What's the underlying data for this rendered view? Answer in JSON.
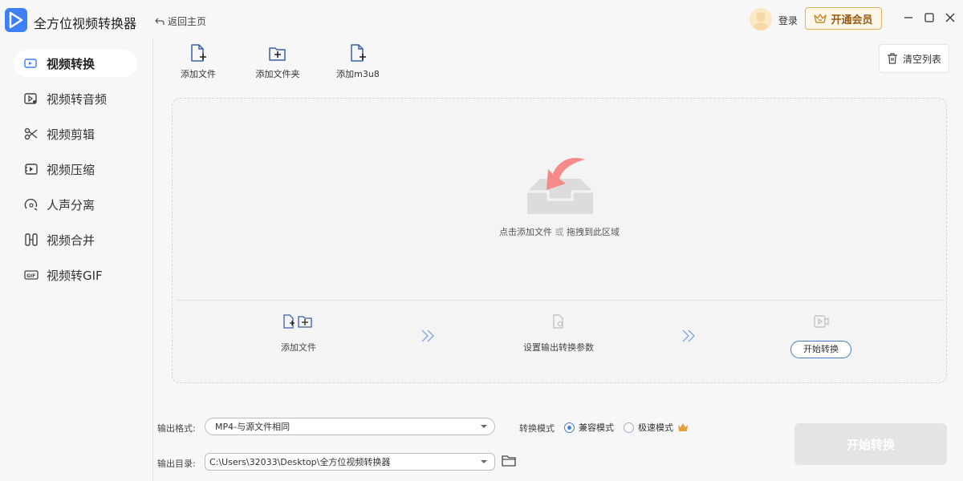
{
  "app": {
    "title": "全方位视频转换器",
    "back_label": "返回主页",
    "login_label": "登录",
    "vip_label": "开通会员",
    "accent_color": "#3d7ff5"
  },
  "sidebar": {
    "items": [
      {
        "label": "视频转换",
        "icon": "video-convert-icon",
        "active": true
      },
      {
        "label": "视频转音频",
        "icon": "video-to-audio-icon",
        "active": false
      },
      {
        "label": "视频剪辑",
        "icon": "scissors-icon",
        "active": false
      },
      {
        "label": "视频压缩",
        "icon": "compress-icon",
        "active": false
      },
      {
        "label": "人声分离",
        "icon": "voice-separation-icon",
        "active": false
      },
      {
        "label": "视频合并",
        "icon": "merge-icon",
        "active": false
      },
      {
        "label": "视频转GIF",
        "icon": "gif-icon",
        "active": false
      }
    ]
  },
  "toolbar": {
    "add_file_label": "添加文件",
    "add_folder_label": "添加文件夹",
    "add_m3u8_label": "添加m3u8",
    "clear_list_label": "清空列表"
  },
  "dropzone": {
    "hint_main": "点击添加文件",
    "hint_or": "或",
    "hint_drag": "拖拽到此区域"
  },
  "steps": {
    "step1_label": "添加文件",
    "step2_label": "设置输出转换参数",
    "step3_label": "开始转换"
  },
  "bottom": {
    "format_label": "输出格式:",
    "format_value": "MP4-与源文件相同",
    "mode_label": "转换模式",
    "mode_options": [
      "兼容模式",
      "极速模式"
    ],
    "mode_selected": "兼容模式",
    "dir_label": "输出目录:",
    "dir_value": "C:\\Users\\32033\\Desktop\\全方位视频转换器",
    "start_button": "开始转换"
  }
}
